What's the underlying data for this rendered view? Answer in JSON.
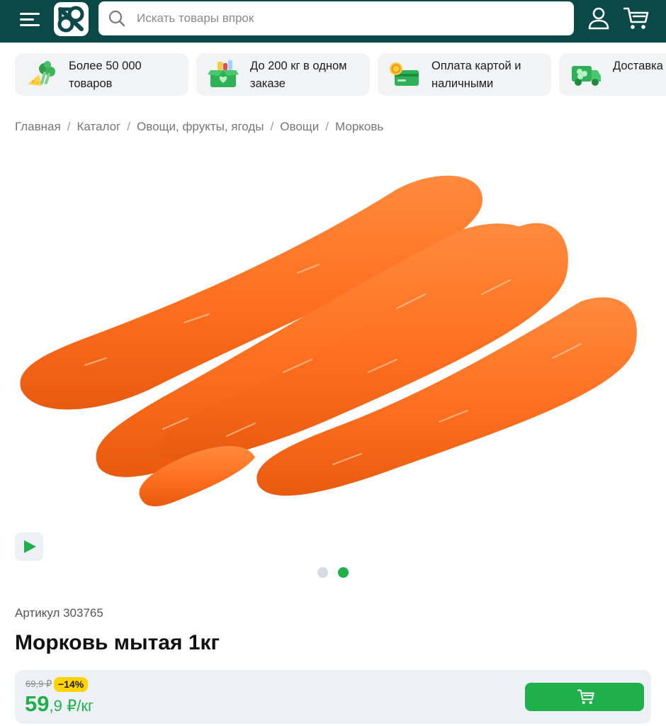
{
  "header": {
    "search_placeholder": "Искать товары впрок",
    "brand_color": "#0b4949"
  },
  "features": [
    {
      "icon": "broccoli-cheese-icon",
      "text": "Более 50 000 товаров"
    },
    {
      "icon": "box-heart-icon",
      "text": "До 200 кг в одном заказе"
    },
    {
      "icon": "card-coin-icon",
      "text": "Оплата картой и наличными"
    },
    {
      "icon": "delivery-truck-icon",
      "text": "Доставка заказа"
    }
  ],
  "breadcrumbs": [
    "Главная",
    "Каталог",
    "Овощи, фрукты, ягоды",
    "Овощи",
    "Морковь"
  ],
  "gallery": {
    "total_slides": 2,
    "active_slide": 2
  },
  "product": {
    "sku_label": "Артикул 303765",
    "title": "Морковь мытая 1кг",
    "old_price": "69,9 ₽",
    "discount": "−14%",
    "price_int": "59",
    "price_frac": ",9",
    "price_unit": "₽/кг",
    "accent_color": "#1fb04b"
  }
}
